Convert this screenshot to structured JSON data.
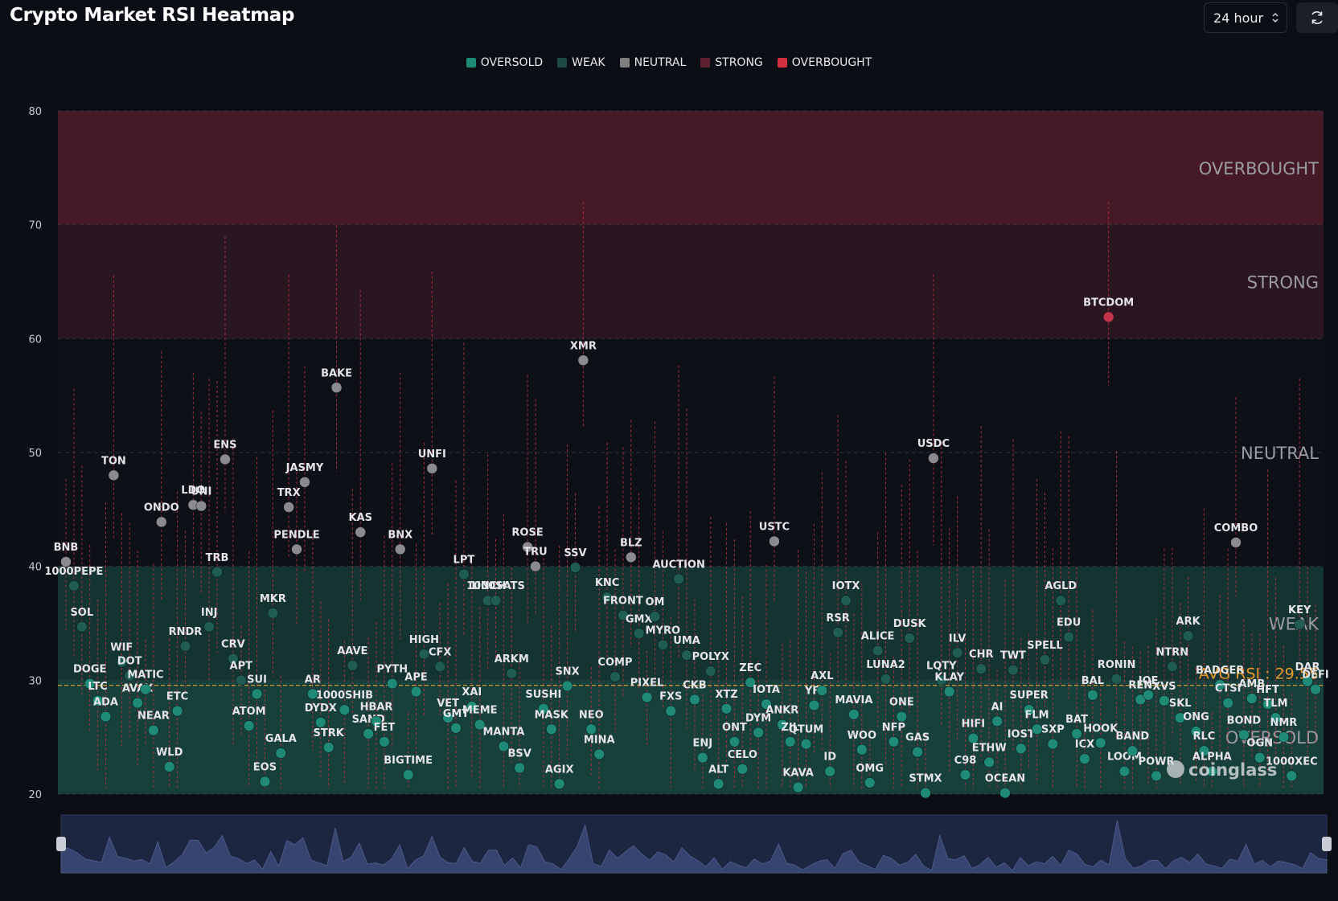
{
  "title": "Crypto Market RSI Heatmap",
  "timeframe": {
    "value": "24 hour"
  },
  "controls": {
    "refresh_icon": "refresh-icon"
  },
  "watermark": "coinglass",
  "colors": {
    "oversold": "#1f8a75",
    "weak": "#1d4a45",
    "neutral": "#808080",
    "strong": "#5e2130",
    "overbought": "#d32f3f",
    "avg_line": "#e3a23a",
    "background": "#0c0e15"
  },
  "chart_data": {
    "type": "scatter",
    "ylim": [
      20,
      80
    ],
    "yticks": [
      20,
      30,
      40,
      50,
      60,
      70,
      80
    ],
    "legend": [
      {
        "name": "OVERSOLD",
        "color": "#1f8a75"
      },
      {
        "name": "WEAK",
        "color": "#1d4a45"
      },
      {
        "name": "NEUTRAL",
        "color": "#808080"
      },
      {
        "name": "STRONG",
        "color": "#5e2130"
      },
      {
        "name": "OVERBOUGHT",
        "color": "#d32f3f"
      }
    ],
    "legend_position": "top-center",
    "zones": [
      {
        "name": "OVERSOLD",
        "from": 20,
        "to": 30
      },
      {
        "name": "WEAK",
        "from": 30,
        "to": 40
      },
      {
        "name": "NEUTRAL",
        "from": 40,
        "to": 60
      },
      {
        "name": "STRONG",
        "from": 60,
        "to": 70
      },
      {
        "name": "OVERBOUGHT",
        "from": 70,
        "to": 80
      }
    ],
    "avg_rsi": {
      "label": "AVG RSI : 29.55",
      "value": 29.55
    },
    "points": [
      {
        "label": "BNB",
        "rsi": 40.4
      },
      {
        "label": "1000PEPE",
        "rsi": 38.3
      },
      {
        "label": "SOL",
        "rsi": 34.7
      },
      {
        "label": "DOGE",
        "rsi": 29.7
      },
      {
        "label": "LTC",
        "rsi": 28.2
      },
      {
        "label": "ADA",
        "rsi": 26.8
      },
      {
        "label": "TON",
        "rsi": 48.0
      },
      {
        "label": "WIF",
        "rsi": 31.6
      },
      {
        "label": "DOT",
        "rsi": 30.4
      },
      {
        "label": "AVAX",
        "rsi": 28.0
      },
      {
        "label": "MATIC",
        "rsi": 29.2
      },
      {
        "label": "NEAR",
        "rsi": 25.6
      },
      {
        "label": "ONDO",
        "rsi": 43.9
      },
      {
        "label": "WLD",
        "rsi": 22.4
      },
      {
        "label": "ETC",
        "rsi": 27.3
      },
      {
        "label": "RNDR",
        "rsi": 33.0
      },
      {
        "label": "LDO",
        "rsi": 45.4
      },
      {
        "label": "UNI",
        "rsi": 45.3
      },
      {
        "label": "INJ",
        "rsi": 34.7
      },
      {
        "label": "TRB",
        "rsi": 39.5
      },
      {
        "label": "ENS",
        "rsi": 49.4
      },
      {
        "label": "CRV",
        "rsi": 31.9
      },
      {
        "label": "APT",
        "rsi": 30.0
      },
      {
        "label": "ATOM",
        "rsi": 26.0
      },
      {
        "label": "SUI",
        "rsi": 28.8
      },
      {
        "label": "EOS",
        "rsi": 21.1
      },
      {
        "label": "MKR",
        "rsi": 35.9
      },
      {
        "label": "GALA",
        "rsi": 23.6
      },
      {
        "label": "TRX",
        "rsi": 45.2
      },
      {
        "label": "PENDLE",
        "rsi": 41.5
      },
      {
        "label": "JASMY",
        "rsi": 47.4
      },
      {
        "label": "AR",
        "rsi": 28.8
      },
      {
        "label": "DYDX",
        "rsi": 26.3
      },
      {
        "label": "STRK",
        "rsi": 24.1
      },
      {
        "label": "BAKE",
        "rsi": 55.7
      },
      {
        "label": "1000SHIB",
        "rsi": 27.4
      },
      {
        "label": "AAVE",
        "rsi": 31.3
      },
      {
        "label": "KAS",
        "rsi": 43.0
      },
      {
        "label": "SAND",
        "rsi": 25.3
      },
      {
        "label": "HBAR",
        "rsi": 26.4
      },
      {
        "label": "FET",
        "rsi": 24.6
      },
      {
        "label": "PYTH",
        "rsi": 29.7
      },
      {
        "label": "BNX",
        "rsi": 41.5
      },
      {
        "label": "BIGTIME",
        "rsi": 21.7
      },
      {
        "label": "APE",
        "rsi": 29.0
      },
      {
        "label": "HIGH",
        "rsi": 32.3
      },
      {
        "label": "UNFI",
        "rsi": 48.6
      },
      {
        "label": "CFX",
        "rsi": 31.2
      },
      {
        "label": "VET",
        "rsi": 26.7
      },
      {
        "label": "GMT",
        "rsi": 25.8
      },
      {
        "label": "LPT",
        "rsi": 39.3
      },
      {
        "label": "XAI",
        "rsi": 27.7
      },
      {
        "label": "MEME",
        "rsi": 26.1
      },
      {
        "label": "1INCH",
        "rsi": 37.0
      },
      {
        "label": "1000SATS",
        "rsi": 37.0
      },
      {
        "label": "MANTA",
        "rsi": 24.2
      },
      {
        "label": "ARKM",
        "rsi": 30.6
      },
      {
        "label": "BSV",
        "rsi": 22.3
      },
      {
        "label": "ROSE",
        "rsi": 41.7
      },
      {
        "label": "TRU",
        "rsi": 40.0
      },
      {
        "label": "SUSHI",
        "rsi": 27.5
      },
      {
        "label": "MASK",
        "rsi": 25.7
      },
      {
        "label": "AGIX",
        "rsi": 20.9
      },
      {
        "label": "SNX",
        "rsi": 29.5
      },
      {
        "label": "SSV",
        "rsi": 39.9
      },
      {
        "label": "XMR",
        "rsi": 58.1
      },
      {
        "label": "NEO",
        "rsi": 25.7
      },
      {
        "label": "MINA",
        "rsi": 23.5
      },
      {
        "label": "KNC",
        "rsi": 37.3
      },
      {
        "label": "COMP",
        "rsi": 30.3
      },
      {
        "label": "FRONT",
        "rsi": 35.7
      },
      {
        "label": "BLZ",
        "rsi": 40.8
      },
      {
        "label": "GMX",
        "rsi": 34.1
      },
      {
        "label": "PIXEL",
        "rsi": 28.5
      },
      {
        "label": "OM",
        "rsi": 35.6
      },
      {
        "label": "MYRO",
        "rsi": 33.1
      },
      {
        "label": "FXS",
        "rsi": 27.3
      },
      {
        "label": "AUCTION",
        "rsi": 38.9
      },
      {
        "label": "UMA",
        "rsi": 32.2
      },
      {
        "label": "CKB",
        "rsi": 28.3
      },
      {
        "label": "ENJ",
        "rsi": 23.2
      },
      {
        "label": "POLYX",
        "rsi": 30.8
      },
      {
        "label": "ALT",
        "rsi": 20.9
      },
      {
        "label": "XTZ",
        "rsi": 27.5
      },
      {
        "label": "ONT",
        "rsi": 24.6
      },
      {
        "label": "CELO",
        "rsi": 22.2
      },
      {
        "label": "ZEC",
        "rsi": 29.8
      },
      {
        "label": "DYM",
        "rsi": 25.4
      },
      {
        "label": "IOTA",
        "rsi": 27.9
      },
      {
        "label": "USTC",
        "rsi": 42.2
      },
      {
        "label": "ANKR",
        "rsi": 26.1
      },
      {
        "label": "ZIL",
        "rsi": 24.6
      },
      {
        "label": "KAVA",
        "rsi": 20.6
      },
      {
        "label": "QTUM",
        "rsi": 24.4
      },
      {
        "label": "YFI",
        "rsi": 27.8
      },
      {
        "label": "AXL",
        "rsi": 29.1
      },
      {
        "label": "ID",
        "rsi": 22.0
      },
      {
        "label": "RSR",
        "rsi": 34.2
      },
      {
        "label": "IOTX",
        "rsi": 37.0
      },
      {
        "label": "MAVIA",
        "rsi": 27.0
      },
      {
        "label": "WOO",
        "rsi": 23.9
      },
      {
        "label": "OMG",
        "rsi": 21.0
      },
      {
        "label": "ALICE",
        "rsi": 32.6
      },
      {
        "label": "LUNA2",
        "rsi": 30.1
      },
      {
        "label": "NFP",
        "rsi": 24.6
      },
      {
        "label": "ONE",
        "rsi": 26.8
      },
      {
        "label": "DUSK",
        "rsi": 33.7
      },
      {
        "label": "GAS",
        "rsi": 23.7
      },
      {
        "label": "STMX",
        "rsi": 20.1
      },
      {
        "label": "USDC",
        "rsi": 49.5
      },
      {
        "label": "LQTY",
        "rsi": 30.0
      },
      {
        "label": "KLAY",
        "rsi": 29.0
      },
      {
        "label": "ILV",
        "rsi": 32.4
      },
      {
        "label": "C98",
        "rsi": 21.7
      },
      {
        "label": "HIFI",
        "rsi": 24.9
      },
      {
        "label": "CHR",
        "rsi": 31.0
      },
      {
        "label": "ETHW",
        "rsi": 22.8
      },
      {
        "label": "AI",
        "rsi": 26.4
      },
      {
        "label": "OCEAN",
        "rsi": 20.1
      },
      {
        "label": "TWT",
        "rsi": 30.9
      },
      {
        "label": "IOST",
        "rsi": 24.0
      },
      {
        "label": "SUPER",
        "rsi": 27.4
      },
      {
        "label": "FLM",
        "rsi": 25.7
      },
      {
        "label": "SPELL",
        "rsi": 31.8
      },
      {
        "label": "SXP",
        "rsi": 24.4
      },
      {
        "label": "AGLD",
        "rsi": 37.0
      },
      {
        "label": "EDU",
        "rsi": 33.8
      },
      {
        "label": "BAT",
        "rsi": 25.3
      },
      {
        "label": "ICX",
        "rsi": 23.1
      },
      {
        "label": "BAL",
        "rsi": 28.7
      },
      {
        "label": "HOOK",
        "rsi": 24.5
      },
      {
        "label": "BTCDOM",
        "rsi": 61.9
      },
      {
        "label": "RONIN",
        "rsi": 30.1
      },
      {
        "label": "LOOM",
        "rsi": 22.0
      },
      {
        "label": "BAND",
        "rsi": 23.8
      },
      {
        "label": "REN",
        "rsi": 28.3
      },
      {
        "label": "JOE",
        "rsi": 28.7
      },
      {
        "label": "POWR",
        "rsi": 21.6
      },
      {
        "label": "XVS",
        "rsi": 28.2
      },
      {
        "label": "NTRN",
        "rsi": 31.2
      },
      {
        "label": "SKL",
        "rsi": 26.7
      },
      {
        "label": "ARK",
        "rsi": 33.9
      },
      {
        "label": "ONG",
        "rsi": 25.5
      },
      {
        "label": "RLC",
        "rsi": 23.8
      },
      {
        "label": "ALPHA",
        "rsi": 22.0
      },
      {
        "label": "BADGER",
        "rsi": 29.6
      },
      {
        "label": "CTSI",
        "rsi": 28.0
      },
      {
        "label": "COMBO",
        "rsi": 42.1
      },
      {
        "label": "BOND",
        "rsi": 25.2
      },
      {
        "label": "AMB",
        "rsi": 28.4
      },
      {
        "label": "OGN",
        "rsi": 23.2
      },
      {
        "label": "HFT",
        "rsi": 27.9
      },
      {
        "label": "TLM",
        "rsi": 26.7
      },
      {
        "label": "NMR",
        "rsi": 25.0
      },
      {
        "label": "1000XEC",
        "rsi": 21.6
      },
      {
        "label": "KEY",
        "rsi": 34.9
      },
      {
        "label": "DAR",
        "rsi": 29.9
      },
      {
        "label": "DEFI",
        "rsi": 29.2
      }
    ]
  }
}
